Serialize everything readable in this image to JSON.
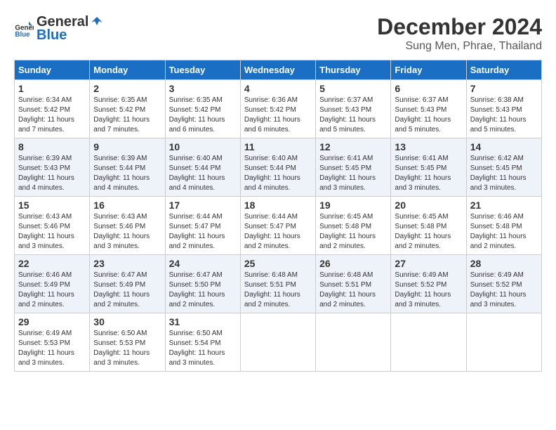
{
  "header": {
    "logo_general": "General",
    "logo_blue": "Blue",
    "title": "December 2024",
    "subtitle": "Sung Men, Phrae, Thailand"
  },
  "days_of_week": [
    "Sunday",
    "Monday",
    "Tuesday",
    "Wednesday",
    "Thursday",
    "Friday",
    "Saturday"
  ],
  "weeks": [
    [
      {
        "day": "1",
        "sunrise": "6:34 AM",
        "sunset": "5:42 PM",
        "daylight": "11 hours and 7 minutes."
      },
      {
        "day": "2",
        "sunrise": "6:35 AM",
        "sunset": "5:42 PM",
        "daylight": "11 hours and 7 minutes."
      },
      {
        "day": "3",
        "sunrise": "6:35 AM",
        "sunset": "5:42 PM",
        "daylight": "11 hours and 6 minutes."
      },
      {
        "day": "4",
        "sunrise": "6:36 AM",
        "sunset": "5:42 PM",
        "daylight": "11 hours and 6 minutes."
      },
      {
        "day": "5",
        "sunrise": "6:37 AM",
        "sunset": "5:43 PM",
        "daylight": "11 hours and 5 minutes."
      },
      {
        "day": "6",
        "sunrise": "6:37 AM",
        "sunset": "5:43 PM",
        "daylight": "11 hours and 5 minutes."
      },
      {
        "day": "7",
        "sunrise": "6:38 AM",
        "sunset": "5:43 PM",
        "daylight": "11 hours and 5 minutes."
      }
    ],
    [
      {
        "day": "8",
        "sunrise": "6:39 AM",
        "sunset": "5:43 PM",
        "daylight": "11 hours and 4 minutes."
      },
      {
        "day": "9",
        "sunrise": "6:39 AM",
        "sunset": "5:44 PM",
        "daylight": "11 hours and 4 minutes."
      },
      {
        "day": "10",
        "sunrise": "6:40 AM",
        "sunset": "5:44 PM",
        "daylight": "11 hours and 4 minutes."
      },
      {
        "day": "11",
        "sunrise": "6:40 AM",
        "sunset": "5:44 PM",
        "daylight": "11 hours and 4 minutes."
      },
      {
        "day": "12",
        "sunrise": "6:41 AM",
        "sunset": "5:45 PM",
        "daylight": "11 hours and 3 minutes."
      },
      {
        "day": "13",
        "sunrise": "6:41 AM",
        "sunset": "5:45 PM",
        "daylight": "11 hours and 3 minutes."
      },
      {
        "day": "14",
        "sunrise": "6:42 AM",
        "sunset": "5:45 PM",
        "daylight": "11 hours and 3 minutes."
      }
    ],
    [
      {
        "day": "15",
        "sunrise": "6:43 AM",
        "sunset": "5:46 PM",
        "daylight": "11 hours and 3 minutes."
      },
      {
        "day": "16",
        "sunrise": "6:43 AM",
        "sunset": "5:46 PM",
        "daylight": "11 hours and 3 minutes."
      },
      {
        "day": "17",
        "sunrise": "6:44 AM",
        "sunset": "5:47 PM",
        "daylight": "11 hours and 2 minutes."
      },
      {
        "day": "18",
        "sunrise": "6:44 AM",
        "sunset": "5:47 PM",
        "daylight": "11 hours and 2 minutes."
      },
      {
        "day": "19",
        "sunrise": "6:45 AM",
        "sunset": "5:48 PM",
        "daylight": "11 hours and 2 minutes."
      },
      {
        "day": "20",
        "sunrise": "6:45 AM",
        "sunset": "5:48 PM",
        "daylight": "11 hours and 2 minutes."
      },
      {
        "day": "21",
        "sunrise": "6:46 AM",
        "sunset": "5:48 PM",
        "daylight": "11 hours and 2 minutes."
      }
    ],
    [
      {
        "day": "22",
        "sunrise": "6:46 AM",
        "sunset": "5:49 PM",
        "daylight": "11 hours and 2 minutes."
      },
      {
        "day": "23",
        "sunrise": "6:47 AM",
        "sunset": "5:49 PM",
        "daylight": "11 hours and 2 minutes."
      },
      {
        "day": "24",
        "sunrise": "6:47 AM",
        "sunset": "5:50 PM",
        "daylight": "11 hours and 2 minutes."
      },
      {
        "day": "25",
        "sunrise": "6:48 AM",
        "sunset": "5:51 PM",
        "daylight": "11 hours and 2 minutes."
      },
      {
        "day": "26",
        "sunrise": "6:48 AM",
        "sunset": "5:51 PM",
        "daylight": "11 hours and 2 minutes."
      },
      {
        "day": "27",
        "sunrise": "6:49 AM",
        "sunset": "5:52 PM",
        "daylight": "11 hours and 3 minutes."
      },
      {
        "day": "28",
        "sunrise": "6:49 AM",
        "sunset": "5:52 PM",
        "daylight": "11 hours and 3 minutes."
      }
    ],
    [
      {
        "day": "29",
        "sunrise": "6:49 AM",
        "sunset": "5:53 PM",
        "daylight": "11 hours and 3 minutes."
      },
      {
        "day": "30",
        "sunrise": "6:50 AM",
        "sunset": "5:53 PM",
        "daylight": "11 hours and 3 minutes."
      },
      {
        "day": "31",
        "sunrise": "6:50 AM",
        "sunset": "5:54 PM",
        "daylight": "11 hours and 3 minutes."
      },
      null,
      null,
      null,
      null
    ]
  ]
}
